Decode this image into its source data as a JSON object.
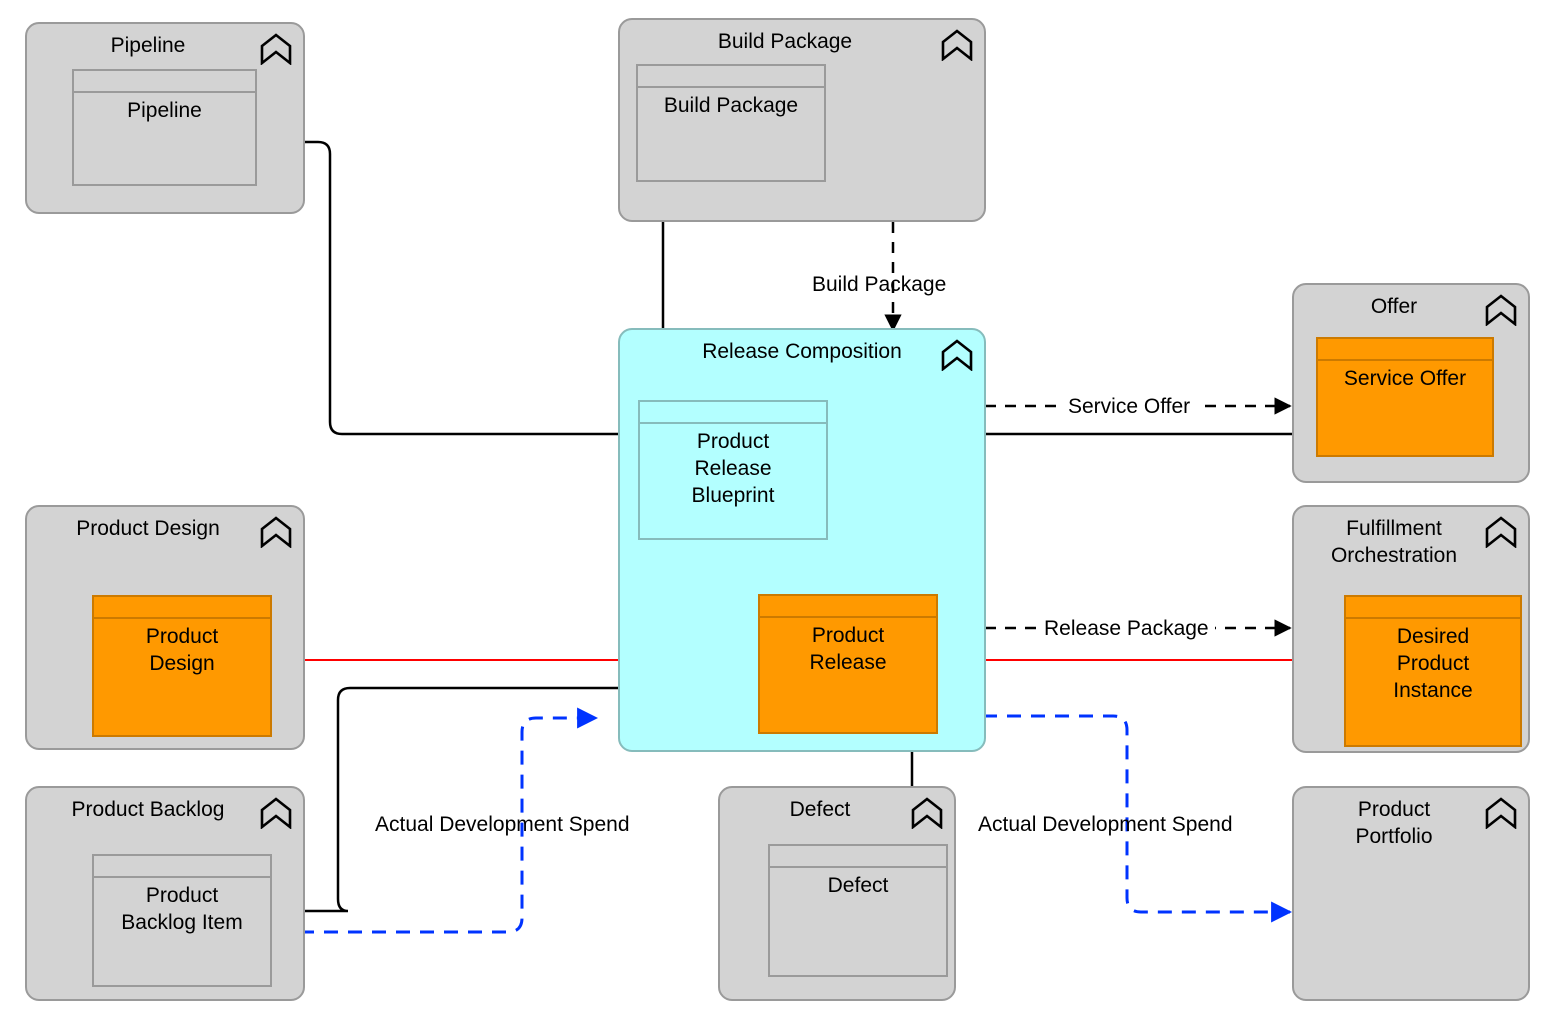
{
  "diagram": {
    "title": "Release Composition capability diagram",
    "colors": {
      "group_fill": "#d3d3d3",
      "group_stroke": "#9a9a9a",
      "highlight_fill": "#b3ffff",
      "highlight_stroke": "#86bcbc",
      "element_fill": "#ff9900",
      "element_stroke": "#cc7a00",
      "line_black": "#000000",
      "line_red": "#ff0000",
      "line_blue": "#0033ff",
      "line_purple": "#800080"
    }
  },
  "groups": {
    "pipeline": {
      "title": "Pipeline",
      "element": "Pipeline"
    },
    "build_package": {
      "title": "Build Package",
      "element": "Build Package"
    },
    "release_composition": {
      "title": "Release Composition",
      "element_blueprint": "Product\nRelease\nBlueprint",
      "element_release": "Product\nRelease"
    },
    "offer": {
      "title": "Offer",
      "element": "Service Offer"
    },
    "fulfillment_orchestration": {
      "title": "Fulfillment\nOrchestration",
      "element": "Desired\nProduct\nInstance"
    },
    "product_design": {
      "title": "Product Design",
      "element": "Product\nDesign"
    },
    "product_backlog": {
      "title": "Product Backlog",
      "element": "Product\nBacklog Item"
    },
    "defect": {
      "title": "Defect",
      "element": "Defect"
    },
    "product_portfolio": {
      "title": "Product\nPortfolio",
      "element": ""
    }
  },
  "connector_labels": {
    "build_package": "Build Package",
    "service_offer": "Service Offer",
    "release_package": "Release Package",
    "actual_dev_spend_left": "Actual Development Spend",
    "actual_dev_spend_right": "Actual Development Spend"
  },
  "icons": {
    "grouping": "grouping-chevron-icon"
  }
}
